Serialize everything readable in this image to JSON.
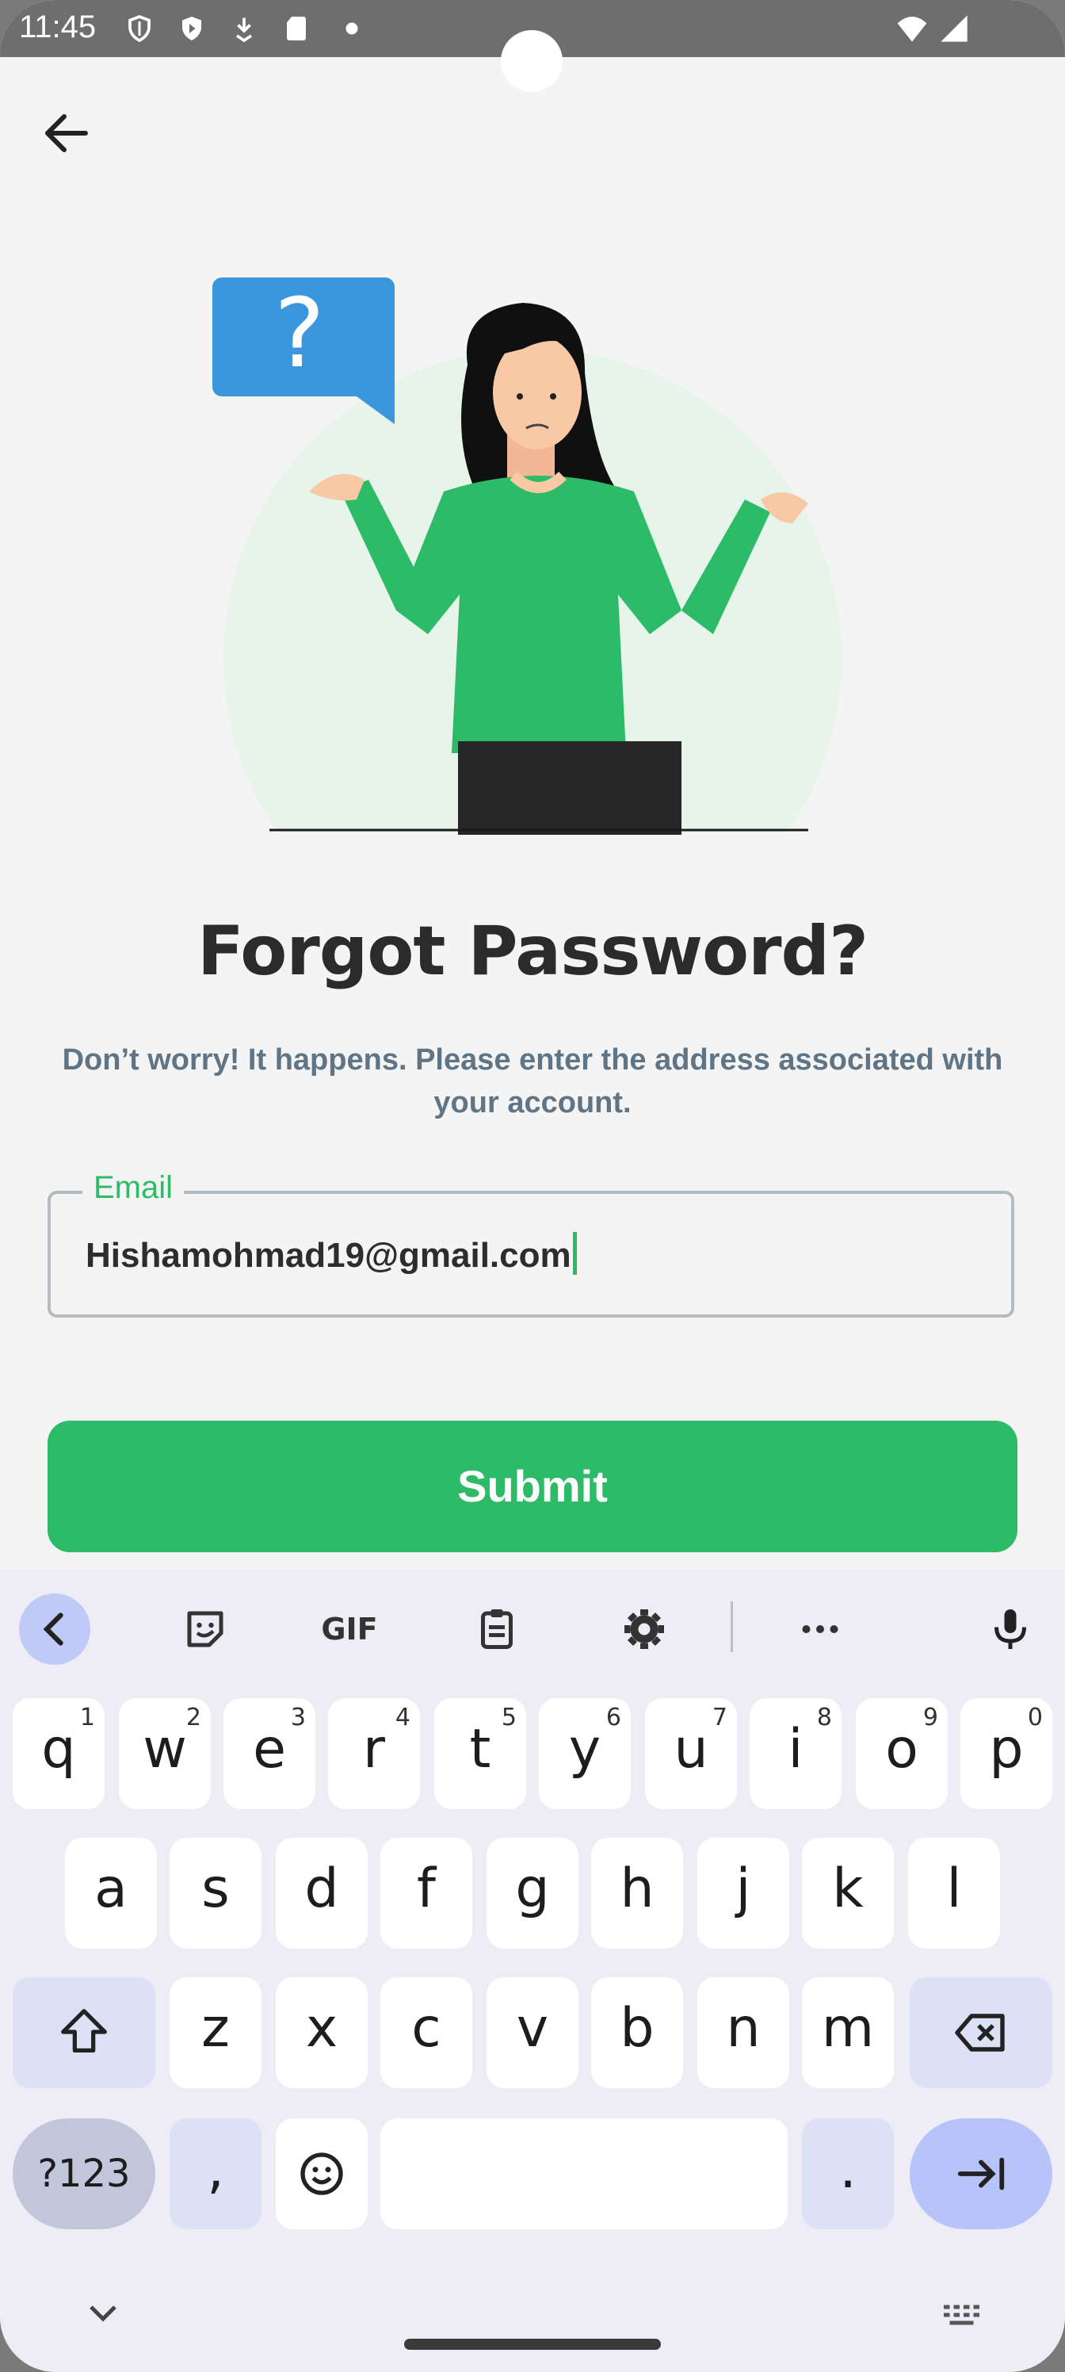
{
  "status_bar": {
    "time": "11:45",
    "icons": [
      "shield-icon",
      "play-shield-icon",
      "download-icon",
      "sd-card-icon",
      "dot-icon",
      "wifi-icon",
      "signal-icon"
    ]
  },
  "header": {
    "back_icon": "arrow-left-icon"
  },
  "illustration": {
    "name": "confused-woman-question-illustration"
  },
  "title": "Forgot Password?",
  "subtitle": "Don’t worry! It happens. Please enter the address associated with your account.",
  "email_field": {
    "label": "Email",
    "value": "Hishamohmad19@gmail.com"
  },
  "submit_label": "Submit",
  "keyboard": {
    "toolbar": [
      "chevron-left-icon",
      "sticker-icon",
      "gif-icon",
      "clipboard-icon",
      "gear-icon",
      "more-icon",
      "microphone-icon"
    ],
    "gif_label": "GIF",
    "row1": [
      {
        "k": "q",
        "h": "1"
      },
      {
        "k": "w",
        "h": "2"
      },
      {
        "k": "e",
        "h": "3"
      },
      {
        "k": "r",
        "h": "4"
      },
      {
        "k": "t",
        "h": "5"
      },
      {
        "k": "y",
        "h": "6"
      },
      {
        "k": "u",
        "h": "7"
      },
      {
        "k": "i",
        "h": "8"
      },
      {
        "k": "o",
        "h": "9"
      },
      {
        "k": "p",
        "h": "0"
      }
    ],
    "row2": [
      "a",
      "s",
      "d",
      "f",
      "g",
      "h",
      "j",
      "k",
      "l"
    ],
    "row3": [
      "z",
      "x",
      "c",
      "v",
      "b",
      "n",
      "m"
    ],
    "mode_key": "?123",
    "comma_key": ",",
    "period_key": ".",
    "emoji_icon": "smiley-icon",
    "shift_icon": "shift-icon",
    "backspace_icon": "backspace-icon",
    "enter_icon": "tab-arrow-icon"
  },
  "colors": {
    "accent": "#2dbb67",
    "statusbar": "#6e6e6e",
    "keyboard_bg": "#eeedf5"
  }
}
